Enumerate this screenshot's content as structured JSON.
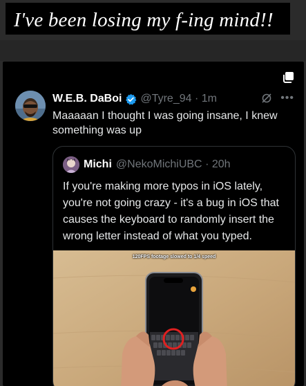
{
  "story": {
    "caption": "I've been losing my f-ing mind!!"
  },
  "tweet": {
    "author_name": "W.E.B. DaBoi",
    "author_handle": "@Tyre_94",
    "time": "1m",
    "text": "Maaaaan I thought I was going insane, I knew something was up",
    "icons": {
      "verified": "verified-badge-icon",
      "grok": "grok-icon",
      "more": "more-icon",
      "copy": "copy-icon"
    }
  },
  "quote": {
    "author_name": "Michi",
    "author_handle": "@NekoMichiUBC",
    "time": "20h",
    "text": "If you're making more typos in iOS lately, you're not going crazy - it's a bug in iOS that causes the keyboard to randomly insert the wrong letter instead of what you typed.",
    "media_caption": "120FPS footage slowed to 1/4 speed"
  },
  "colors": {
    "accent": "#1d9bf0",
    "handle": "#71767b",
    "text": "#e7e9ea",
    "highlight": "#e02020"
  }
}
